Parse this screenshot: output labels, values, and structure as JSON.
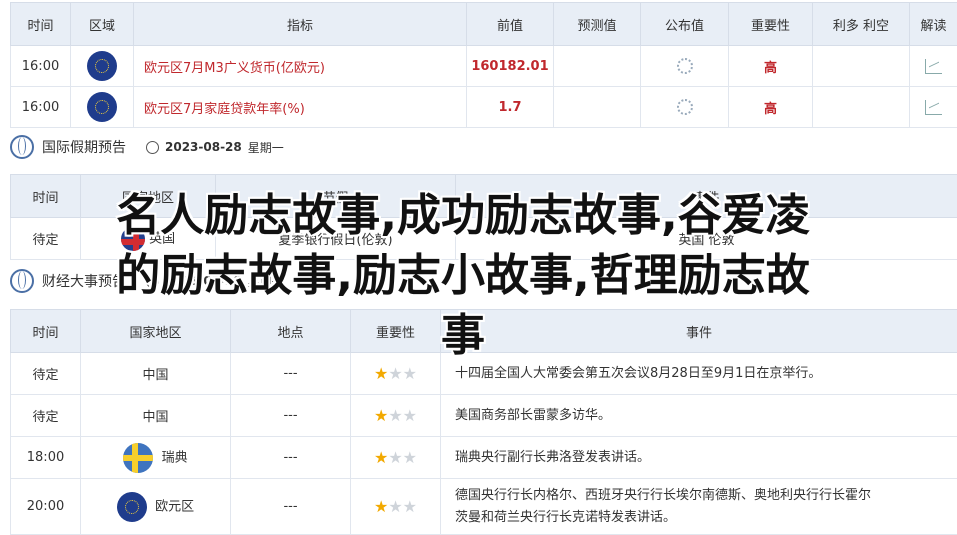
{
  "table1": {
    "headers": [
      "时间",
      "区域",
      "指标",
      "前值",
      "预测值",
      "公布值",
      "重要性",
      "利多 利空",
      "解读"
    ],
    "rows": [
      {
        "time": "16:00",
        "indicator": "欧元区7月M3广义货币(亿欧元)",
        "prev": "160182.01",
        "importance": "高"
      },
      {
        "time": "16:00",
        "indicator": "欧元区7月家庭贷款年率(%)",
        "prev": "1.7",
        "importance": "高"
      }
    ]
  },
  "holiday": {
    "title": "国际假期预告",
    "date": "2023-08-28",
    "weekday": "星期一",
    "headers": [
      "时间",
      "国家地区",
      "节假",
      "事件"
    ],
    "row": {
      "time": "待定",
      "country": "英国",
      "col3": "夏季银行假日(伦敦)",
      "col4": "英国 伦敦"
    }
  },
  "events_section": {
    "title": "财经大事预告",
    "date": "2023-08-28",
    "weekday": "星期一"
  },
  "table2": {
    "headers": [
      "时间",
      "国家地区",
      "地点",
      "重要性",
      "事件"
    ],
    "rows": [
      {
        "time": "待定",
        "country": "中国",
        "place": "---",
        "stars": 1,
        "event": "十四届全国人大常委会第五次会议8月28日至9月1日在京举行。"
      },
      {
        "time": "待定",
        "country": "中国",
        "place": "---",
        "stars": 1,
        "event": "美国商务部长雷蒙多访华。"
      },
      {
        "time": "18:00",
        "country": "瑞典",
        "place": "---",
        "stars": 1,
        "event": "瑞典央行副行长弗洛登发表讲话。"
      },
      {
        "time": "20:00",
        "country": "欧元区",
        "place": "---",
        "stars": 1,
        "event_line1": "德国央行行长内格尔、西班牙央行行长埃尔南德斯、奥地利央行行长霍尔",
        "event_line2": "茨曼和荷兰央行行长克诺特发表讲话。"
      }
    ]
  },
  "overlay_text": {
    "line1": "名人励志故事,成功励志故事,谷爱凌",
    "line2": "的励志故事,励志小故事,哲理励志故",
    "line3": "事"
  },
  "colors": {
    "accent": "#c0282d",
    "header_bg": "#e8eef6",
    "star": "#f2a900"
  }
}
